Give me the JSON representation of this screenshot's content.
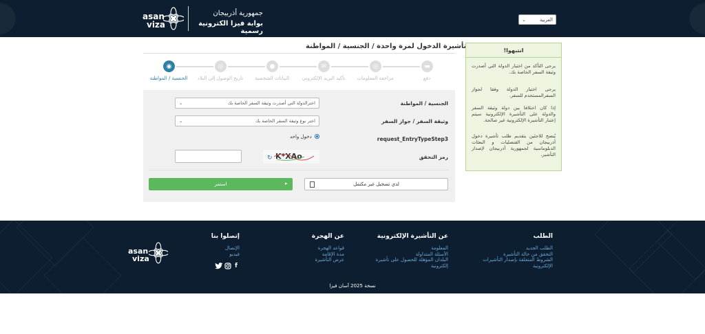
{
  "header": {
    "logo_line1": "asan",
    "logo_line2": "viza",
    "title_line1": "جمهورية أذربيجان",
    "title_line2": "بوابة فيزا الكترونية رسمية",
    "language": "العربية"
  },
  "page_title": "طلب تأشيرة الدخول لمرة واحدة / الجنسية / المواطنة",
  "steps": [
    {
      "label": "الجنسية / المواطنة",
      "active": true
    },
    {
      "label": "تاريخ الوصول إلى البلاد",
      "active": false
    },
    {
      "label": "البيانات الشخصية",
      "active": false
    },
    {
      "label": "تأكيد البريد الإلكتروني",
      "active": false
    },
    {
      "label": "مراجعة المعلومات",
      "active": false
    },
    {
      "label": "دفع",
      "active": false
    }
  ],
  "form": {
    "nationality_label": "الجنسية / المواطنة",
    "nationality_placeholder": "اخترالدولة التي أصدرت وثيقة السفر الخاصة بك",
    "travel_doc_label": "وثيقة السفر / جواز السفر",
    "travel_doc_placeholder": "اختر نوع وثيقة السفر الخاصة بك",
    "entry_type_label": "request_EntryTypeStep3",
    "entry_type_option": "دخول واحد",
    "captcha_label": "رمز التحقق",
    "captcha_text": "K*XAo"
  },
  "buttons": {
    "continue": "استمر",
    "incomplete": "لدي تسجيل غير مكتمل"
  },
  "warning": {
    "title": "!انتبهوا",
    "p1": "يرجى التأكد من اختيار الدولة التي أصدرت وثيقة السفر الخاصة بك.",
    "p2": "يرجى اختيار الدولة وفقا لجواز السفرالمستخدم للسفر.",
    "p3": "إذا كان اختلافا بين دولة وثيقة السفر والدولة على التأشيرة الإلكترونية سيتم إعتبار التأشيرة الإلكترونية غير صالحة.",
    "p4": "يُنصح للاجئين بتقديم طلب تأشيرة دخول أذربيجان من القنصليات و البعثات الدبلوماسية لجمهورية أذربيجان لإصدار التأشير."
  },
  "footer": {
    "col_request": {
      "title": "الطلب",
      "links": [
        "الطلب الجديد",
        "التحقق من حالة التأشيرة",
        "الشروط المتعلقة بإصدار التأشيرات",
        "الإلكترونية"
      ]
    },
    "col_evisa": {
      "title": "عن التأشيرة الإلكترونية",
      "links": [
        "المعلومة",
        "الأسئلة المتداولة",
        "البلدان المؤهلة للحصول على تأشيرة",
        "إلكترونية"
      ]
    },
    "col_migration": {
      "title": "عن الهجرة",
      "links": [
        "قواعد الهجرة",
        "مدة الإقامة",
        "عرض التأشيرة"
      ]
    },
    "col_contact": {
      "title": "إتصلوا بنا",
      "links": [
        "الإتصال",
        "فيديو"
      ]
    },
    "copyright": "نسخة 2025 آسان فيزا"
  },
  "colors": {
    "header_bg": "#0c1e30",
    "active_step": "#2d7fa6",
    "continue_button": "#5cb85c",
    "warning_bg": "#edf5e1",
    "link": "#6fa8d8"
  }
}
